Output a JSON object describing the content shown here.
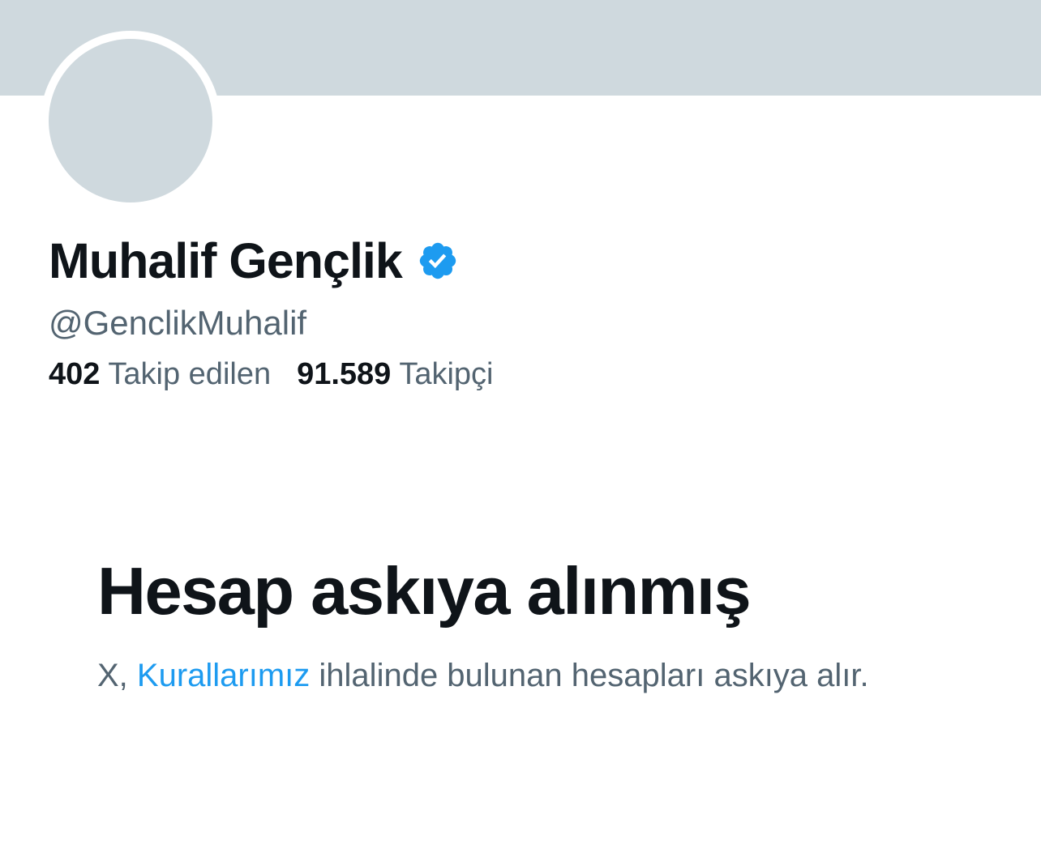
{
  "profile": {
    "display_name": "Muhalif Gençlik",
    "handle": "@GenclikMuhalif",
    "verified_icon": "verified-badge-icon",
    "following_count": "402",
    "following_label": "Takip edilen",
    "followers_count": "91.589",
    "followers_label": "Takipçi"
  },
  "suspension": {
    "title": "Hesap askıya alınmış",
    "text_prefix": "X, ",
    "rules_link": "Kurallarımız",
    "text_suffix": " ihlalinde bulunan hesapları askıya alır."
  },
  "colors": {
    "banner": "#cfd9de",
    "avatar": "#cfd9de",
    "verified": "#1d9bf0",
    "link": "#1d9bf0",
    "primary_text": "#0f1419",
    "secondary_text": "#536471"
  }
}
